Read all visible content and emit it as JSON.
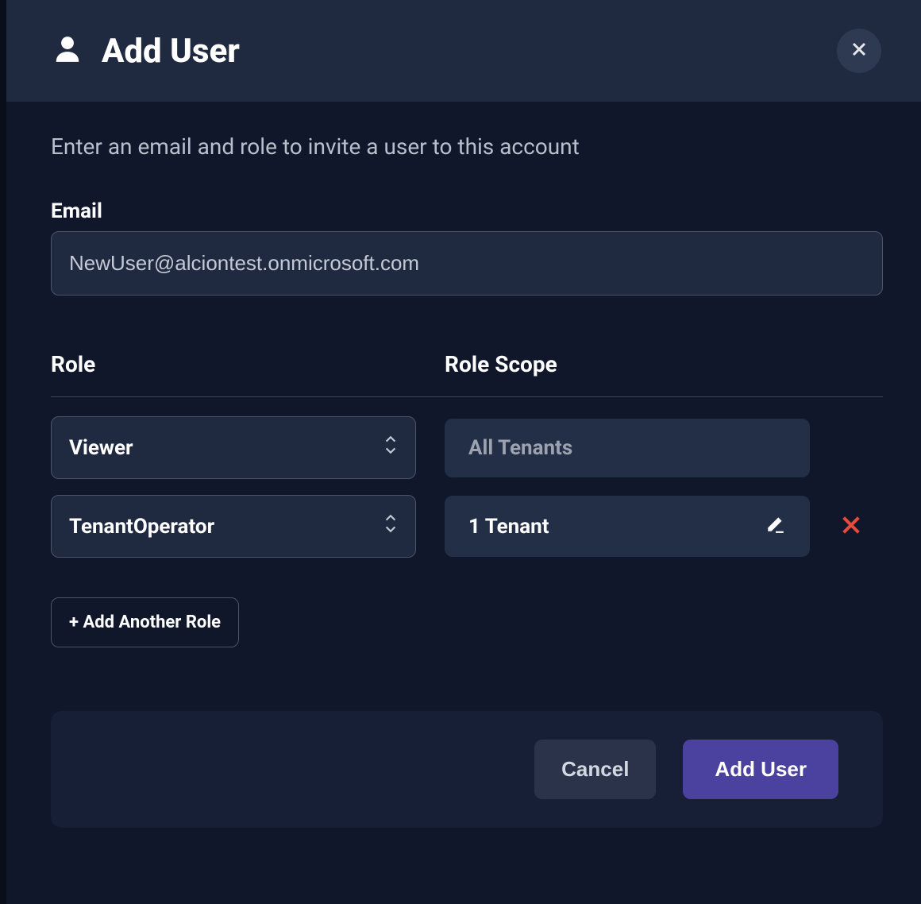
{
  "header": {
    "title": "Add User"
  },
  "description": "Enter an email and role to invite a user to this account",
  "email": {
    "label": "Email",
    "value": "NewUser@alciontest.onmicrosoft.com"
  },
  "columns": {
    "role_label": "Role",
    "scope_label": "Role Scope"
  },
  "roles": [
    {
      "role": "Viewer",
      "scope": "All Tenants",
      "editable": false,
      "removable": false
    },
    {
      "role": "TenantOperator",
      "scope": "1 Tenant",
      "editable": true,
      "removable": true
    }
  ],
  "buttons": {
    "add_role": "+ Add Another Role",
    "cancel": "Cancel",
    "submit": "Add User"
  }
}
